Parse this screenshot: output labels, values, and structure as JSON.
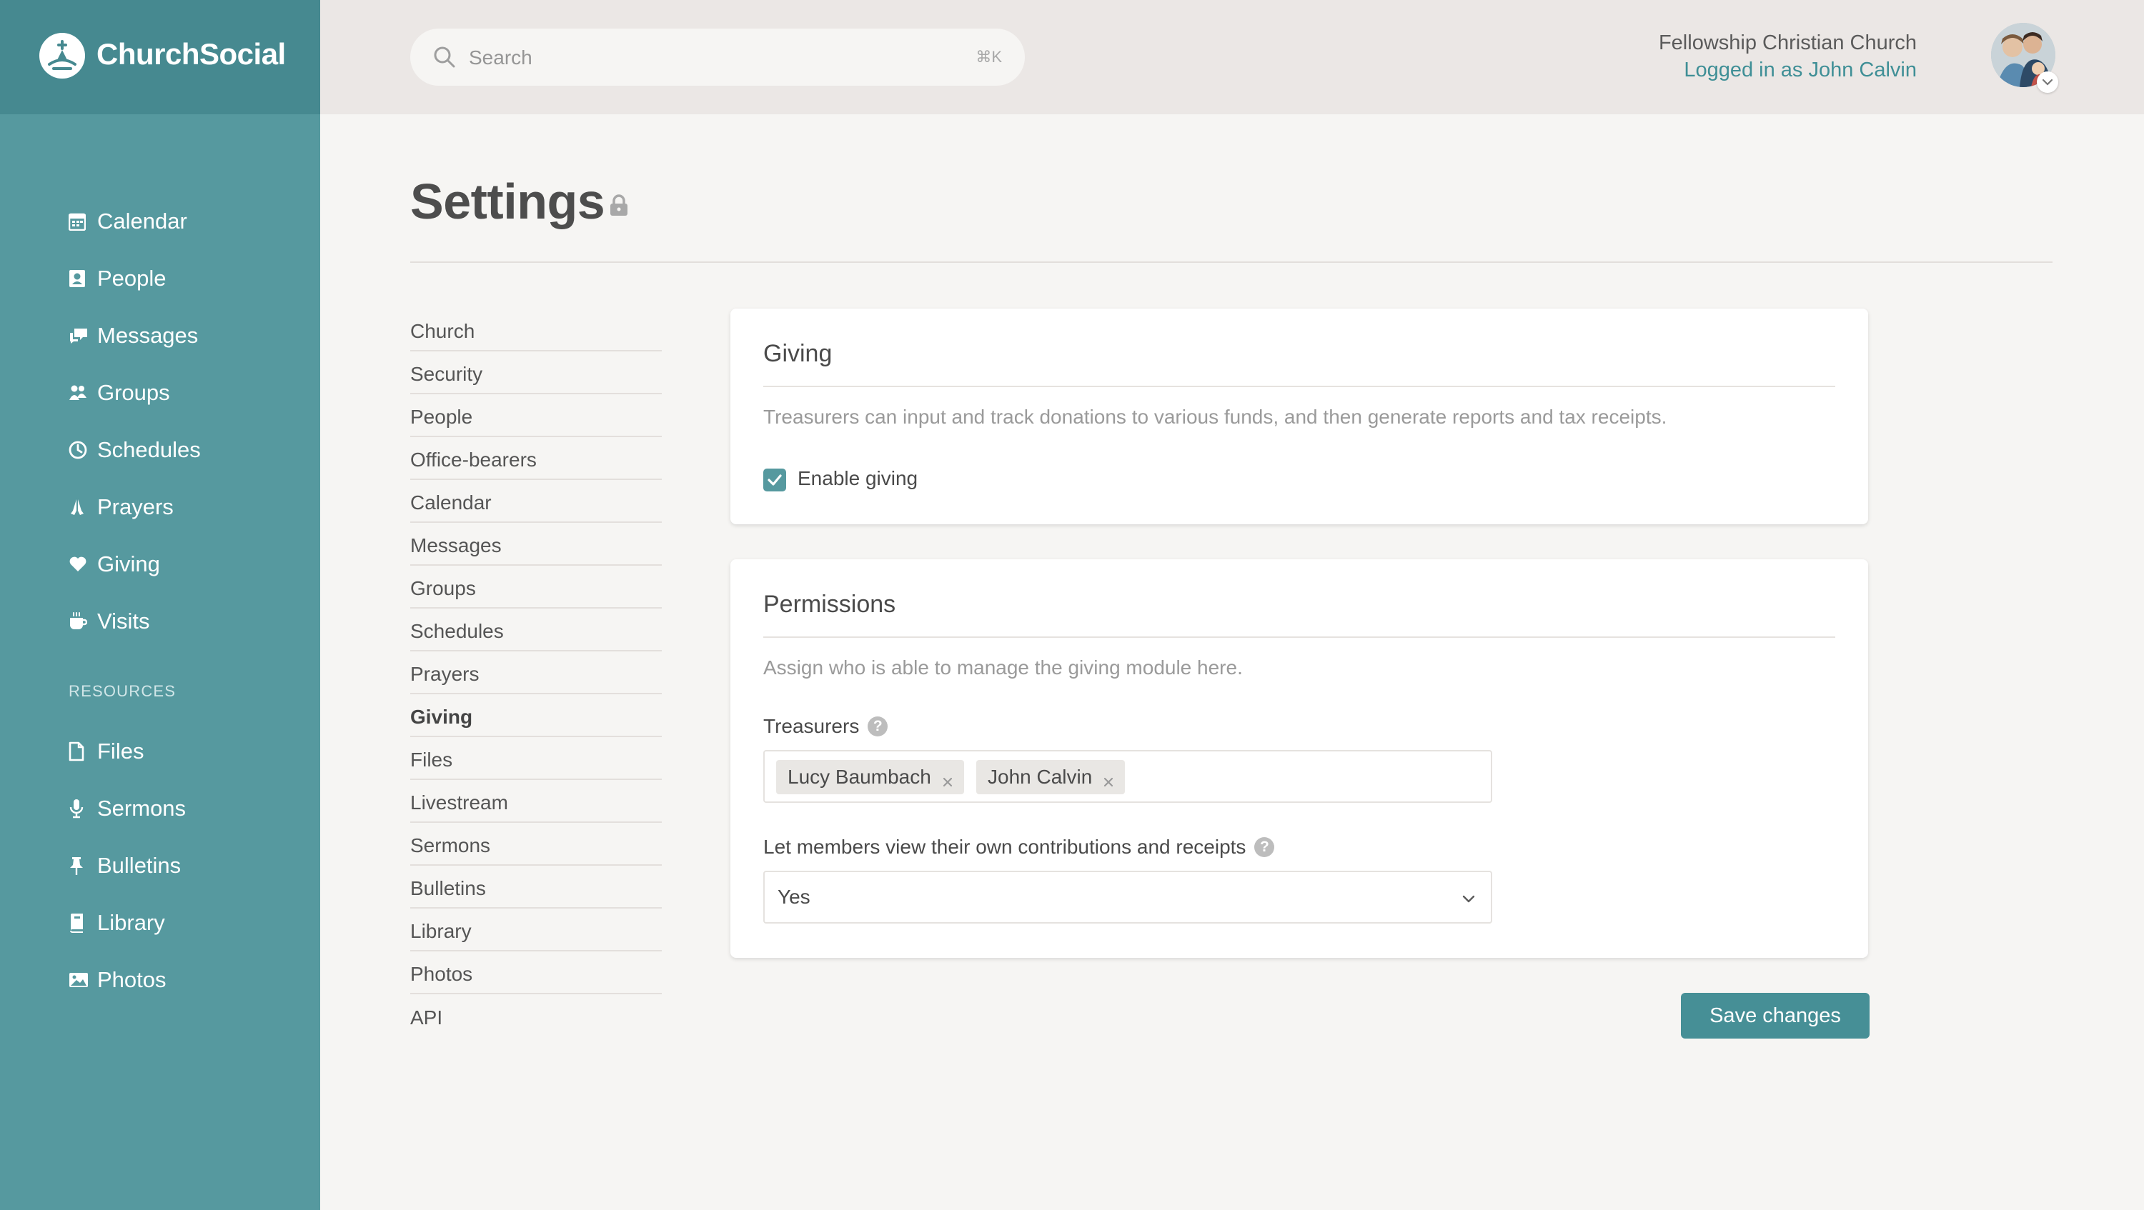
{
  "app": {
    "brand_name": "ChurchSocial",
    "accent_color": "#56999f",
    "brand_bar_color": "#468990",
    "logo_icon": "church-spire-icon"
  },
  "sidebar": {
    "items": [
      {
        "label": "Calendar",
        "icon": "calendar-icon"
      },
      {
        "label": "People",
        "icon": "person-card-icon"
      },
      {
        "label": "Messages",
        "icon": "chat-bubbles-icon"
      },
      {
        "label": "Groups",
        "icon": "group-icon"
      },
      {
        "label": "Schedules",
        "icon": "clock-icon"
      },
      {
        "label": "Prayers",
        "icon": "praying-hands-icon"
      },
      {
        "label": "Giving",
        "icon": "heart-icon"
      },
      {
        "label": "Visits",
        "icon": "coffee-cup-icon"
      }
    ],
    "resources_heading": "RESOURCES",
    "resources": [
      {
        "label": "Files",
        "icon": "file-icon"
      },
      {
        "label": "Sermons",
        "icon": "microphone-icon"
      },
      {
        "label": "Bulletins",
        "icon": "pushpin-icon"
      },
      {
        "label": "Library",
        "icon": "book-icon"
      },
      {
        "label": "Photos",
        "icon": "image-icon"
      }
    ]
  },
  "header": {
    "search_placeholder": "Search",
    "search_shortcut": "⌘K",
    "church_name": "Fellowship Christian Church",
    "logged_in_text": "Logged in as John Calvin"
  },
  "page": {
    "title": "Settings",
    "title_icon": "lock-icon"
  },
  "settings_nav": {
    "active": "Giving",
    "items": [
      "Church",
      "Security",
      "People",
      "Office-bearers",
      "Calendar",
      "Messages",
      "Groups",
      "Schedules",
      "Prayers",
      "Giving",
      "Files",
      "Livestream",
      "Sermons",
      "Bulletins",
      "Library",
      "Photos",
      "API"
    ]
  },
  "giving_card": {
    "title": "Giving",
    "description": "Treasurers can input and track donations to various funds, and then generate reports and tax receipts.",
    "enable_label": "Enable giving",
    "enabled": true
  },
  "permissions_card": {
    "title": "Permissions",
    "description": "Assign who is able to manage the giving module here.",
    "treasurers_label": "Treasurers",
    "treasurers": [
      "Lucy Baumbach",
      "John Calvin"
    ],
    "view_own_label": "Let members view their own contributions and receipts",
    "view_own_value": "Yes",
    "help_glyph": "?"
  },
  "actions": {
    "save_label": "Save changes"
  }
}
